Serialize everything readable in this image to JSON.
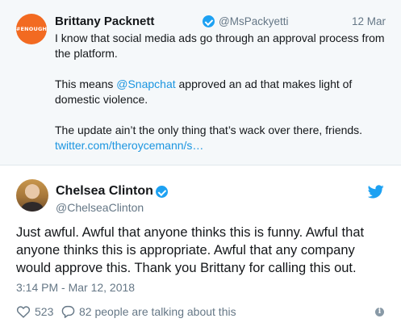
{
  "quoted_tweet": {
    "avatar_label": "#ENOUGH",
    "name": "Brittany Packnett",
    "handle": "@MsPackyetti",
    "date": "12 Mar",
    "paragraphs": {
      "p1": "I know that social media ads go through an approval process from the platform.",
      "p2_prefix": "This means ",
      "p2_mention": "@Snapchat",
      "p2_suffix": " approved an ad that makes light of domestic violence.",
      "p3": "The update ain’t the only thing that’s wack over there, friends.",
      "link": "twitter.com/theroycemann/s…"
    }
  },
  "tweet": {
    "name": "Chelsea Clinton",
    "handle": "@ChelseaClinton",
    "text": "Just awful. Awful that anyone thinks this is funny. Awful that anyone thinks this is appropriate. Awful that any company would approve this. Thank you Brittany for calling this out.",
    "timestamp": "3:14 PM - Mar 12, 2018",
    "likes": "523",
    "talking": "82 people are talking about this"
  },
  "colors": {
    "accent": "#1da1f2",
    "link": "#1b95e0",
    "muted": "#657786",
    "avatar_brand": "#f26a21"
  },
  "icons": [
    "verified-badge-icon",
    "twitter-bird-icon",
    "heart-icon",
    "reply-icon",
    "info-icon"
  ]
}
